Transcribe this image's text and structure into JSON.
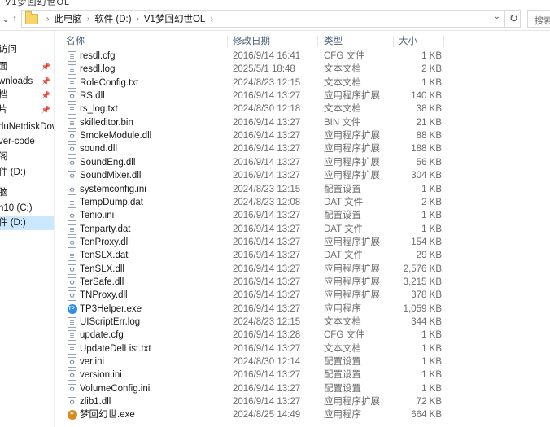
{
  "window": {
    "title_partial": "V1梦回幻世OL"
  },
  "address_bar": {
    "crumbs": [
      "此电脑",
      "软件 (D:)",
      "V1梦回幻世OL"
    ],
    "search_placeholder": "搜索"
  },
  "sidebar": {
    "items": [
      {
        "label": "访问",
        "pinned": false,
        "selected": false
      },
      {
        "label": "面",
        "pinned": true,
        "selected": false
      },
      {
        "label": "wnloads",
        "pinned": true,
        "selected": false
      },
      {
        "label": "档",
        "pinned": true,
        "selected": false
      },
      {
        "label": "片",
        "pinned": true,
        "selected": false
      },
      {
        "label": "duNetdiskDow",
        "pinned": false,
        "selected": false
      },
      {
        "label": "ver-code",
        "pinned": false,
        "selected": false
      },
      {
        "label": "件 (D:)",
        "pinned": false,
        "selected": false
      },
      {
        "label": "阁",
        "pinned": false,
        "selected": false
      },
      {
        "label": "脑",
        "pinned": false,
        "selected": false
      },
      {
        "label": "n10 (C:)",
        "pinned": false,
        "selected": false
      },
      {
        "label": "件 (D:)",
        "pinned": false,
        "selected": true
      }
    ]
  },
  "columns": {
    "name": "名称",
    "date": "修改日期",
    "type": "类型",
    "size": "大小"
  },
  "files": [
    {
      "name": "resdl.cfg",
      "date": "2016/9/14 16:41",
      "type": "CFG 文件",
      "size": "1 KB",
      "icon": "file-icon"
    },
    {
      "name": "resdl.log",
      "date": "2025/5/1 18:48",
      "type": "文本文档",
      "size": "2 KB",
      "icon": "text-file-icon"
    },
    {
      "name": "RoleConfig.txt",
      "date": "2024/8/23 12:15",
      "type": "文本文档",
      "size": "1 KB",
      "icon": "text-file-icon"
    },
    {
      "name": "RS.dll",
      "date": "2016/9/14 13:27",
      "type": "应用程序扩展",
      "size": "140 KB",
      "icon": "dll-icon"
    },
    {
      "name": "rs_log.txt",
      "date": "2024/8/30 12:18",
      "type": "文本文档",
      "size": "38 KB",
      "icon": "text-file-icon"
    },
    {
      "name": "skilleditor.bin",
      "date": "2016/9/14 13:27",
      "type": "BIN 文件",
      "size": "21 KB",
      "icon": "file-icon"
    },
    {
      "name": "SmokeModule.dll",
      "date": "2016/9/14 13:27",
      "type": "应用程序扩展",
      "size": "88 KB",
      "icon": "dll-icon"
    },
    {
      "name": "sound.dll",
      "date": "2016/9/14 13:27",
      "type": "应用程序扩展",
      "size": "188 KB",
      "icon": "dll-icon"
    },
    {
      "name": "SoundEng.dll",
      "date": "2016/9/14 13:27",
      "type": "应用程序扩展",
      "size": "56 KB",
      "icon": "dll-icon"
    },
    {
      "name": "SoundMixer.dll",
      "date": "2016/9/14 13:27",
      "type": "应用程序扩展",
      "size": "304 KB",
      "icon": "dll-icon"
    },
    {
      "name": "systemconfig.ini",
      "date": "2024/8/23 12:15",
      "type": "配置设置",
      "size": "1 KB",
      "icon": "ini-icon"
    },
    {
      "name": "TempDump.dat",
      "date": "2024/8/23 12:08",
      "type": "DAT 文件",
      "size": "2 KB",
      "icon": "file-icon"
    },
    {
      "name": "Tenio.ini",
      "date": "2016/9/14 13:27",
      "type": "配置设置",
      "size": "1 KB",
      "icon": "ini-icon"
    },
    {
      "name": "Tenparty.dat",
      "date": "2016/9/14 13:27",
      "type": "DAT 文件",
      "size": "1 KB",
      "icon": "file-icon"
    },
    {
      "name": "TenProxy.dll",
      "date": "2016/9/14 13:27",
      "type": "应用程序扩展",
      "size": "154 KB",
      "icon": "dll-icon"
    },
    {
      "name": "TenSLX.dat",
      "date": "2016/9/14 13:27",
      "type": "DAT 文件",
      "size": "29 KB",
      "icon": "file-icon"
    },
    {
      "name": "TenSLX.dll",
      "date": "2016/9/14 13:27",
      "type": "应用程序扩展",
      "size": "2,576 KB",
      "icon": "dll-icon"
    },
    {
      "name": "TerSafe.dll",
      "date": "2016/9/14 13:27",
      "type": "应用程序扩展",
      "size": "3,215 KB",
      "icon": "dll-icon"
    },
    {
      "name": "TNProxy.dll",
      "date": "2016/9/14 13:27",
      "type": "应用程序扩展",
      "size": "378 KB",
      "icon": "dll-icon"
    },
    {
      "name": "TP3Helper.exe",
      "date": "2016/9/14 13:27",
      "type": "应用程序",
      "size": "1,059 KB",
      "icon": "tp-exe-icon"
    },
    {
      "name": "UIScriptErr.log",
      "date": "2024/8/23 12:15",
      "type": "文本文档",
      "size": "344 KB",
      "icon": "text-file-icon"
    },
    {
      "name": "update.cfg",
      "date": "2016/9/14 13:28",
      "type": "CFG 文件",
      "size": "1 KB",
      "icon": "file-icon"
    },
    {
      "name": "UpdateDelList.txt",
      "date": "2016/9/14 13:27",
      "type": "文本文档",
      "size": "1 KB",
      "icon": "text-file-icon"
    },
    {
      "name": "ver.ini",
      "date": "2024/8/30 12:14",
      "type": "配置设置",
      "size": "1 KB",
      "icon": "ini-icon"
    },
    {
      "name": "version.ini",
      "date": "2016/9/14 13:27",
      "type": "配置设置",
      "size": "1 KB",
      "icon": "ini-icon"
    },
    {
      "name": "VolumeConfig.ini",
      "date": "2016/9/14 13:27",
      "type": "配置设置",
      "size": "1 KB",
      "icon": "ini-icon"
    },
    {
      "name": "zlib1.dll",
      "date": "2016/9/14 13:27",
      "type": "应用程序扩展",
      "size": "72 KB",
      "icon": "dll-icon"
    },
    {
      "name": "梦回幻世.exe",
      "date": "2024/8/25 14:49",
      "type": "应用程序",
      "size": "664 KB",
      "icon": "game-exe-icon"
    }
  ]
}
